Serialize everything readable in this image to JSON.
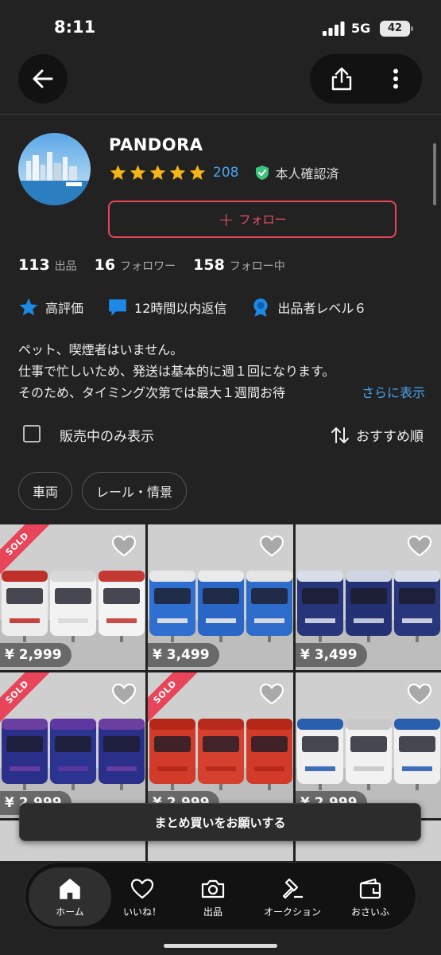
{
  "status_bar": {
    "time": "8:11",
    "network": "5G",
    "battery": "42"
  },
  "profile": {
    "name": "PANDORA",
    "rating_stars": 5,
    "review_count": "208",
    "verified_label": "本人確認済",
    "follow_label": "フォロー"
  },
  "stats": [
    {
      "value": "113",
      "label": "出品"
    },
    {
      "value": "16",
      "label": "フォロワー"
    },
    {
      "value": "158",
      "label": "フォロー中"
    }
  ],
  "badges": [
    {
      "label": "高評価",
      "icon": "star-icon"
    },
    {
      "label": "12時間以内返信",
      "icon": "chat-icon"
    },
    {
      "label": "出品者レベル６",
      "icon": "medal-icon"
    }
  ],
  "bio": {
    "lines": [
      "ペット、喫煙者はいません。",
      "仕事で忙しいため、発送は基本的に週１回になります。",
      "そのため、タイミング次第では最大１週間お待"
    ],
    "more_label": "さらに表示"
  },
  "filter": {
    "on_sale_only_label": "販売中のみ表示",
    "sort_label": "おすすめ順"
  },
  "chips": [
    "車両",
    "レール・情景"
  ],
  "items": [
    {
      "price": "¥ 2,999",
      "sold": true,
      "train": "white-red"
    },
    {
      "price": "¥ 3,499",
      "sold": false,
      "train": "blue-white"
    },
    {
      "price": "¥ 3,499",
      "sold": false,
      "train": "navy-blue"
    },
    {
      "price": "¥ 2,999",
      "sold": true,
      "train": "purple"
    },
    {
      "price": "¥ 2,999",
      "sold": true,
      "train": "red"
    },
    {
      "price": "¥ 2,999",
      "sold": false,
      "train": "white-silver"
    }
  ],
  "sold_label": "SOLD",
  "toast": "まとめ買いをお願いする",
  "tabs": [
    {
      "label": "ホーム",
      "icon": "home-icon",
      "active": true
    },
    {
      "label": "いいね！",
      "icon": "heart-icon",
      "active": false
    },
    {
      "label": "出品",
      "icon": "camera-icon",
      "active": false
    },
    {
      "label": "オークション",
      "icon": "gavel-icon",
      "active": false
    },
    {
      "label": "おさいふ",
      "icon": "wallet-icon",
      "active": false
    }
  ],
  "colors": {
    "accent": "#e8455a",
    "link": "#4aa3f0",
    "star": "#f4b41a",
    "verified": "#3cc37a",
    "badge_blue": "#1e88e5"
  }
}
